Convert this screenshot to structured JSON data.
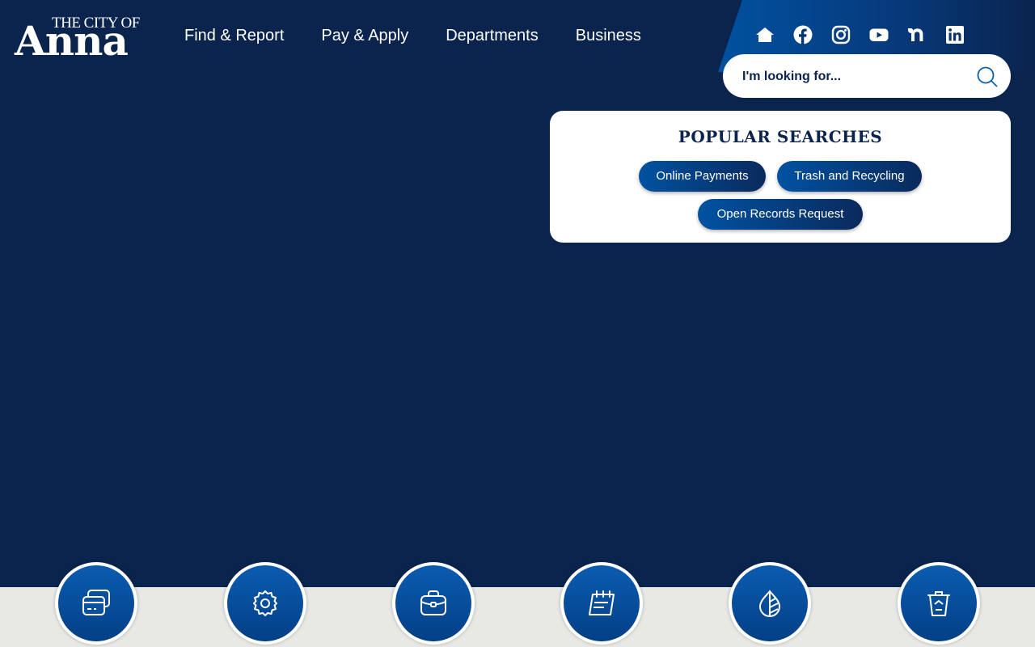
{
  "logo": {
    "top": "THE CITY OF",
    "name": "Anna"
  },
  "nav": [
    "Find & Report",
    "Pay & Apply",
    "Departments",
    "Business"
  ],
  "social": [
    "home-icon",
    "facebook-icon",
    "instagram-icon",
    "youtube-icon",
    "nextdoor-icon",
    "linkedin-icon"
  ],
  "search": {
    "placeholder": "I'm looking for..."
  },
  "popular": {
    "title": "POPULAR SEARCHES",
    "items": [
      "Online Payments",
      "Trash and Recycling",
      "Open Records Request"
    ]
  },
  "quick_links": [
    "payments-icon",
    "services-icon",
    "jobs-icon",
    "calendar-icon",
    "water-icon",
    "trash-icon"
  ],
  "colors": {
    "background": "#0a244e",
    "accent": "#0052a2",
    "band": "#e8e8e4"
  }
}
